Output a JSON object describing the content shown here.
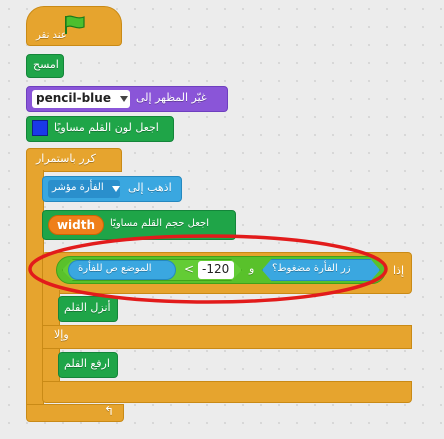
{
  "script": {
    "hat_label": "عند نقر",
    "clear_label": "امسح",
    "switch_costume": {
      "label": "غيّر المظهر إلى",
      "value": "pencil-blue"
    },
    "set_pen_color": {
      "label": "اجعل لون القلم مساويًا",
      "color": "#1a39e8"
    },
    "forever_label": "كرر باستمرار",
    "go_to": {
      "label": "اذهب إلى",
      "value": "الفأرة مؤشر"
    },
    "set_pen_size": {
      "label": "اجعل حجم القلم مساويًا",
      "value": "width"
    },
    "if_label": "إذا",
    "condition": {
      "mouse_down": "زر الفأرة مضغوط؟",
      "and_label": "و",
      "number": "-120",
      "less_than": "<",
      "mouse_y": "الموضع ص للفأرة"
    },
    "pen_down_label": "أنزل القلم",
    "else_label": "وإلا",
    "pen_up_label": "ارفع القلم"
  },
  "icons": {
    "green_flag": "green-flag-icon",
    "loop_arrow": "loop-arrow-icon"
  },
  "annotation": {
    "shape": "red-ellipse",
    "color": "#e21b1b"
  },
  "colors": {
    "control": "#e6a42e",
    "pen": "#1fa548",
    "looks": "#8a55d8",
    "sensing": "#3aa7e0",
    "operators": "#59c12b"
  }
}
